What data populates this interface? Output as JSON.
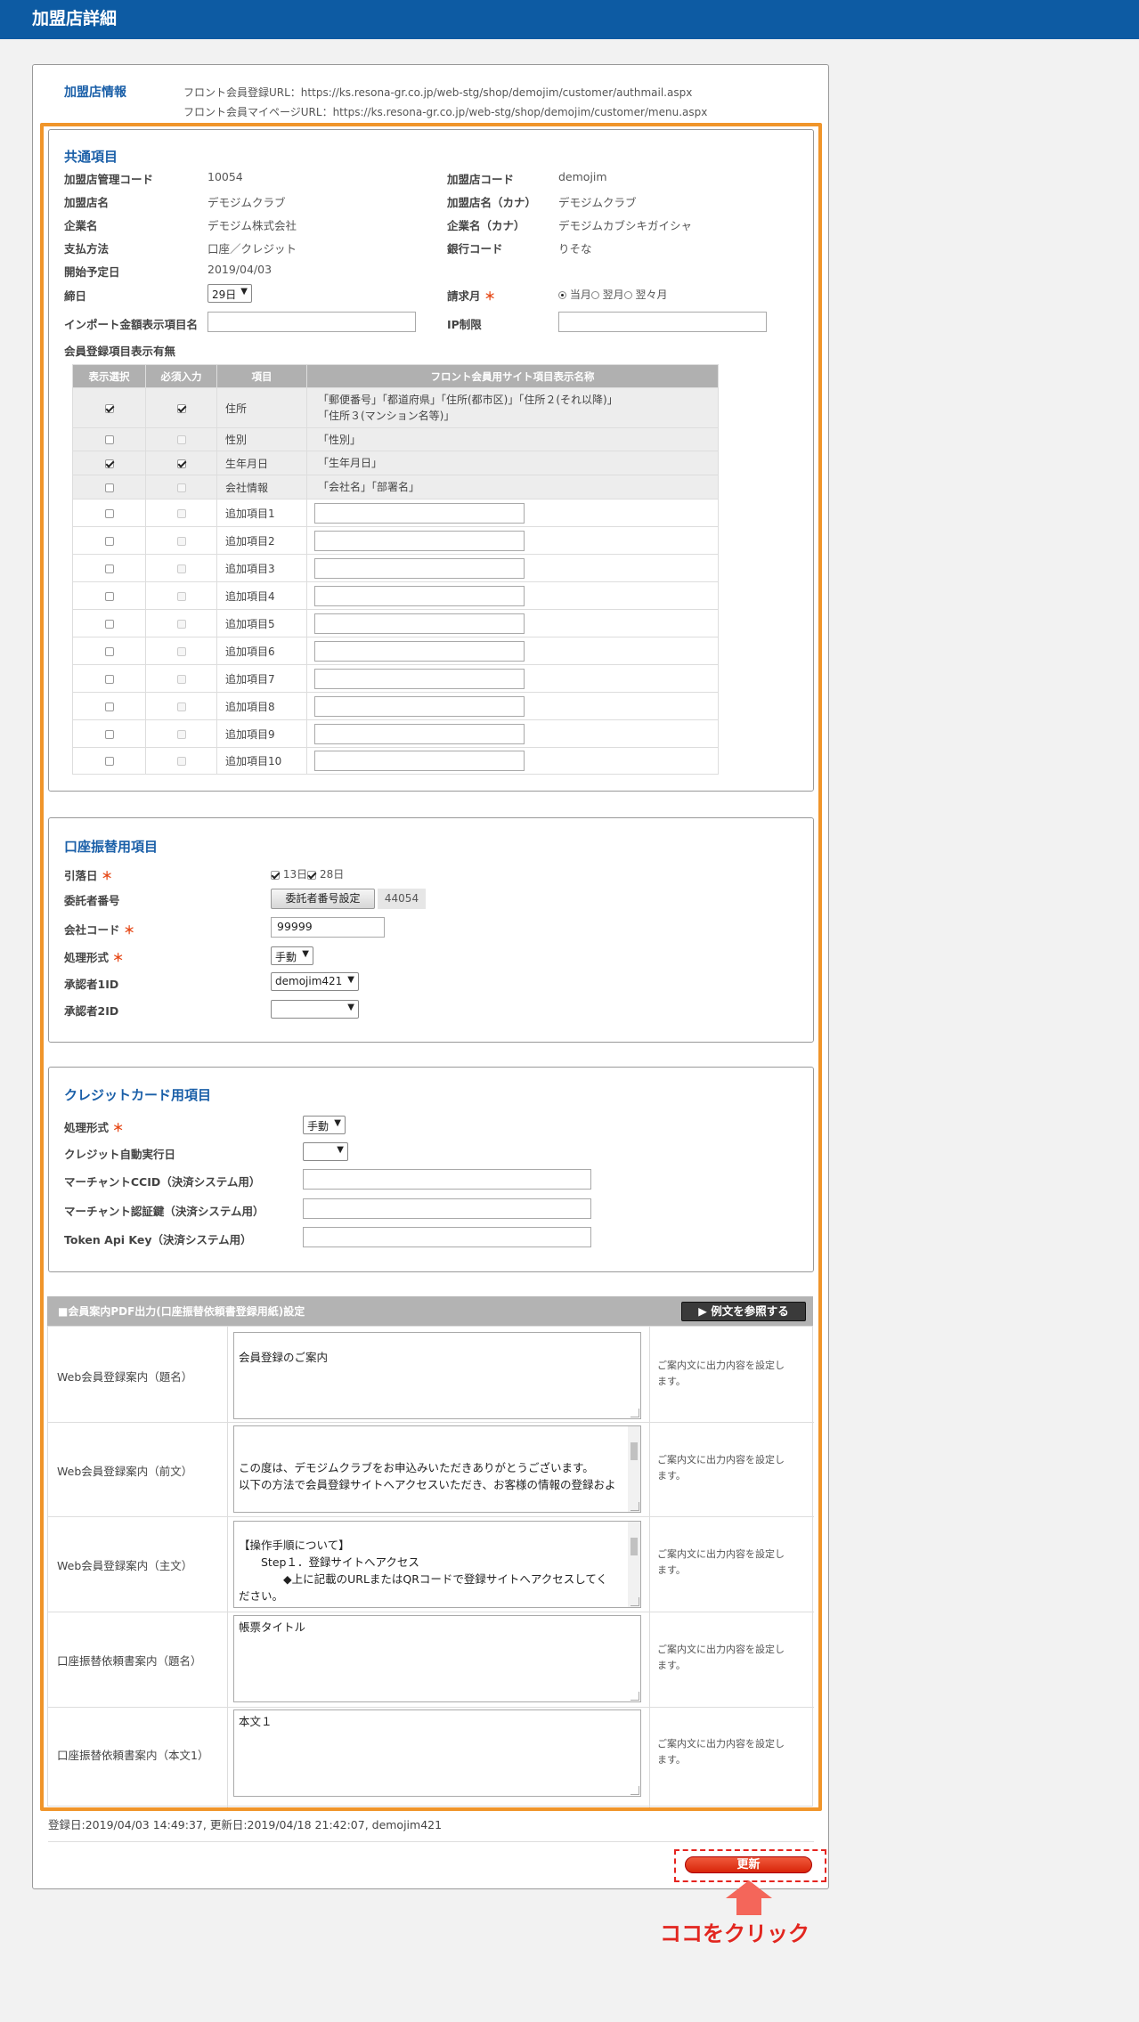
{
  "header": {
    "title": "加盟店詳細"
  },
  "store_info": {
    "heading": "加盟店情報",
    "front_reg_url": "フロント会員登録URL：https://ks.resona-gr.co.jp/web-stg/shop/demojim/customer/authmail.aspx",
    "front_mypage_url": "フロント会員マイページURL：https://ks.resona-gr.co.jp/web-stg/shop/demojim/customer/menu.aspx"
  },
  "common": {
    "heading": "共通項目",
    "mgmt_code_label": "加盟店管理コード",
    "mgmt_code": "10054",
    "store_code_label": "加盟店コード",
    "store_code": "demojim",
    "store_name_label": "加盟店名",
    "store_name": "デモジムクラブ",
    "store_kana_label": "加盟店名（カナ）",
    "store_kana": "デモジムクラブ",
    "company_label": "企業名",
    "company": "デモジム株式会社",
    "company_kana_label": "企業名（カナ）",
    "company_kana": "デモジムカブシキガイシャ",
    "payment_label": "支払方法",
    "payment": "口座／クレジット",
    "bank_label": "銀行コード",
    "bank": "りそな",
    "start_label": "開始予定日",
    "start": "2019/04/03",
    "closing_label": "締日",
    "closing": "29日",
    "billing_label": "請求月",
    "billing_req": "＊",
    "billing_options": [
      "当月",
      "翌月",
      "翌々月"
    ],
    "import_label": "インポート金額表示項目名",
    "ip_label": "IP制限",
    "member_items_label": "会員登録項目表示有無"
  },
  "member_table": {
    "headers": [
      "表示選択",
      "必須入力",
      "項目",
      "フロント会員用サイト項目表示名称"
    ],
    "fixed_rows": [
      {
        "item": "住所",
        "name": "「郵便番号」「都道府県」「住所(都市区)」「住所２(それ以降)」\n「住所３(マンション名等)」",
        "show": true,
        "req": true
      },
      {
        "item": "性別",
        "name": "「性別」",
        "show": false,
        "req": false
      },
      {
        "item": "生年月日",
        "name": "「生年月日」",
        "show": true,
        "req": true
      },
      {
        "item": "会社情報",
        "name": "「会社名」「部署名」",
        "show": false,
        "req": false
      }
    ],
    "extra_rows": [
      "追加項目1",
      "追加項目2",
      "追加項目3",
      "追加項目4",
      "追加項目5",
      "追加項目6",
      "追加項目7",
      "追加項目8",
      "追加項目9",
      "追加項目10"
    ]
  },
  "account": {
    "heading": "口座振替用項目",
    "withdraw_label": "引落日",
    "withdraw_req": "＊",
    "withdraw_opt1": "13日",
    "withdraw_opt2": "28日",
    "trustee_label": "委託者番号",
    "trustee_btn": "委託者番号設定",
    "trustee_value": "44054",
    "company_code_label": "会社コード",
    "company_code_req": "＊",
    "company_code": "99999",
    "process_label": "処理形式",
    "process_req": "＊",
    "process": "手動",
    "approver1_label": "承認者1ID",
    "approver1": "demojim421",
    "approver2_label": "承認者2ID",
    "approver2": ""
  },
  "credit": {
    "heading": "クレジットカード用項目",
    "process_label": "処理形式",
    "process_req": "＊",
    "process": "手動",
    "auto_label": "クレジット自動実行日",
    "auto": "",
    "ccid_label": "マーチャントCCID（決済システム用）",
    "auth_label": "マーチャント認証鍵（決済システム用）",
    "token_label": "Token Api Key（決済システム用）"
  },
  "pdf": {
    "bar_title": "■会員案内PDF出力(口座振替依頼書登録用紙)設定",
    "example_btn": "▶ 例文を参照する",
    "note": "ご案内文に出力内容を設定します。",
    "rows": [
      {
        "label": "Web会員登録案内（題名）",
        "text": "会員登録のご案内"
      },
      {
        "label": "Web会員登録案内（前文）",
        "text": "\nこの度は、デモジムクラブをお申込みいただきありがとうございます。\n以下の方法で会員登録サイトへアクセスいただき、お客様の情報の登録およ"
      },
      {
        "label": "Web会員登録案内（主文）",
        "text": "【操作手順について】\n　　Step１．登録サイトへアクセス\n　　　　◆上に記載のURLまたはQRコードで登録サイトへアクセスしてく\nださい。"
      },
      {
        "label": "口座振替依頼書案内（題名）",
        "text": "帳票タイトル"
      },
      {
        "label": "口座振替依頼書案内（本文1）",
        "text": "本文１"
      }
    ]
  },
  "footer": {
    "timestamps": "登録日:2019/04/03 14:49:37, 更新日:2019/04/18 21:42:07, demojim421",
    "update_btn": "更新",
    "click_hint": "ココをクリック"
  }
}
